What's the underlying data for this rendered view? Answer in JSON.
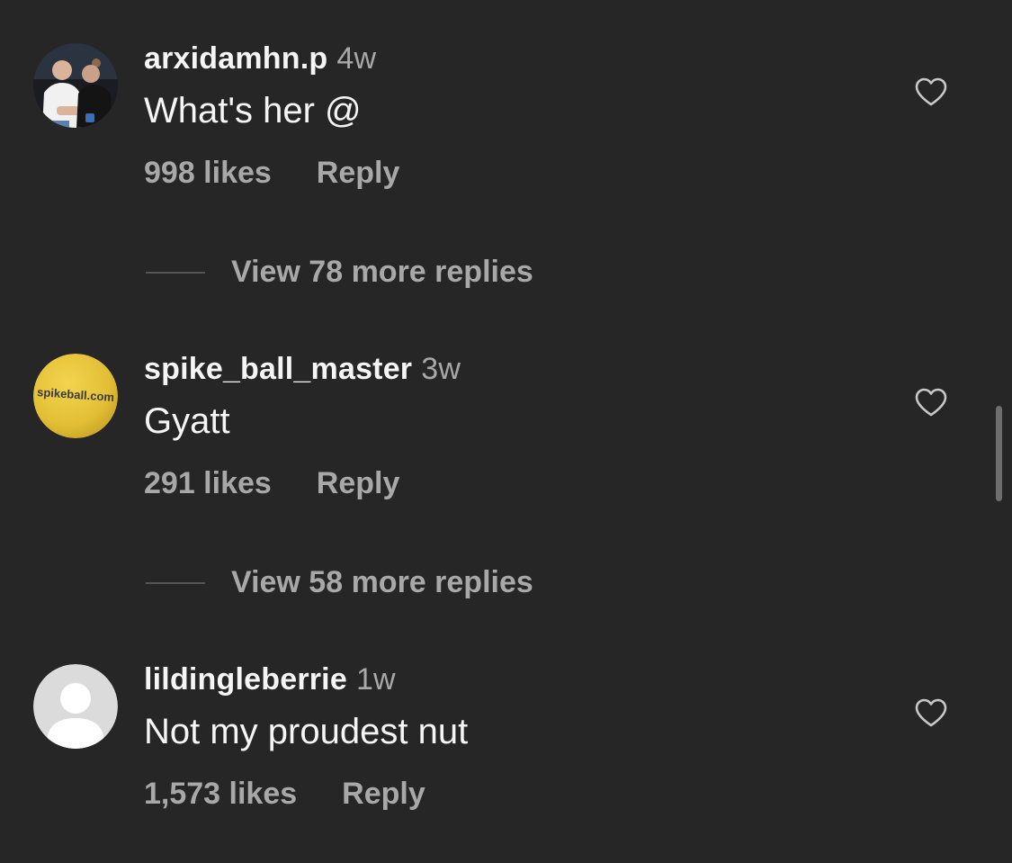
{
  "comments": [
    {
      "username": "arxidamhn.p",
      "time": "4w",
      "text": "What's her @",
      "likes": "998 likes",
      "reply_label": "Reply",
      "view_replies": "View 78 more replies"
    },
    {
      "username": "spike_ball_master",
      "time": "3w",
      "text": "Gyatt",
      "likes": "291 likes",
      "reply_label": "Reply",
      "view_replies": "View 58 more replies",
      "avatar_text": "spikeball.com"
    },
    {
      "username": "lildingleberrie",
      "time": "1w",
      "text": "Not my proudest nut",
      "likes": "1,573 likes",
      "reply_label": "Reply"
    }
  ],
  "icons": {
    "like": "heart-outline-icon",
    "default_avatar": "user-silhouette-icon"
  },
  "colors": {
    "background": "#262626",
    "primary_text": "#f5f5f5",
    "secondary_text": "#a8a8a8",
    "avatar_yellow": "#e6c43a",
    "default_avatar_bg": "#dbdbdb"
  }
}
